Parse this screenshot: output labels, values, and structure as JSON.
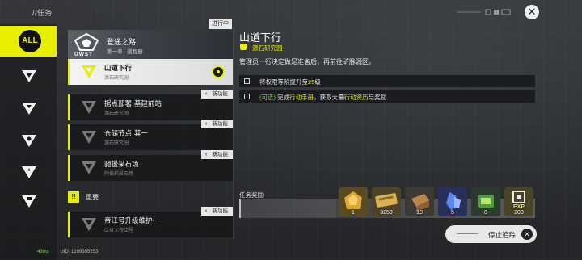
{
  "header": {
    "breadcrumb": "//任务",
    "close_icon": "close-icon"
  },
  "rail": {
    "items": [
      {
        "label": "ALL",
        "icon": "all-icon",
        "active": true
      },
      {
        "icon": "chevron-down-icon"
      },
      {
        "icon": "triangle-mark-icon"
      },
      {
        "icon": "triangle-star-icon"
      },
      {
        "icon": "triangle-star-small-icon"
      },
      {
        "icon": "triangle-badge-icon"
      }
    ]
  },
  "chapter": {
    "title": "登途之路",
    "subtitle": "第一章 - 道程册",
    "emblem_text": "UWST",
    "status": "进行中"
  },
  "quests": [
    {
      "title": "山道下行",
      "subtitle": "源石研究园",
      "selected": true
    },
    {
      "title": "据点部署·基建前站",
      "subtitle": "源石研究园",
      "badge": "新功能"
    },
    {
      "title": "仓储节点·其一",
      "subtitle": "源石研究园",
      "badge": "新功能"
    },
    {
      "title": "驰援采石场",
      "subtitle": "阿伯莉采石场",
      "badge": "新功能"
    }
  ],
  "group": {
    "mark": "!!",
    "label": "重要",
    "quest": {
      "title": "帝江号升级维护·一",
      "subtitle": "O.M.V.帝江号",
      "badge": "新功能"
    }
  },
  "detail": {
    "title": "山道下行",
    "location": "源石研究园",
    "description": "管理员一行决定做足准备后，再前往矿脉源区。",
    "objectives": [
      {
        "pre": "将权限等阶提升至",
        "hl": "25",
        "post": "级"
      },
      {
        "opt": "(可选)",
        "a": " 完成",
        "hl1": "行动手册",
        "b": "，获取大量",
        "hl2": "行动资历",
        "c": "与奖励"
      }
    ]
  },
  "rewards": {
    "label": "任务奖励",
    "items": [
      {
        "name": "gold-crystal",
        "qty": "1",
        "color": "#d8a12a"
      },
      {
        "name": "ticket",
        "qty": "3250",
        "color": "#c9a64a"
      },
      {
        "name": "mineral-box",
        "qty": "10",
        "color": "#a97b3c"
      },
      {
        "name": "blue-crystal",
        "qty": "5",
        "color": "#4b6fd6"
      },
      {
        "name": "green-device",
        "qty": "8",
        "color": "#4f9a46"
      },
      {
        "name": "exp-card",
        "qty": "200",
        "label": "EXP",
        "color": "#d9c64a"
      }
    ]
  },
  "stop_button": {
    "label": "停止追踪"
  },
  "footer": {
    "ping": "43ms",
    "uid": "UID: 1299395253"
  },
  "colors": {
    "accent": "#e8ef00",
    "bg": "#2b2d30",
    "card": "#161719"
  }
}
